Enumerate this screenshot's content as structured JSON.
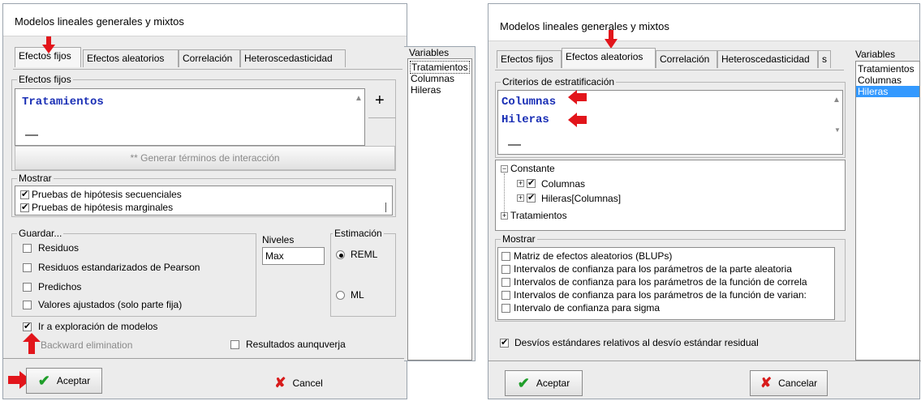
{
  "left": {
    "title": "Modelos lineales generales y mixtos",
    "tabs": [
      "Efectos fijos",
      "Efectos aleatorios",
      "Correlación",
      "Heteroscedasticidad"
    ],
    "efectos_fijos": {
      "label": "Efectos fijos",
      "term": "Tratamientos",
      "dash": "—",
      "plus": "+",
      "interaction_button": "** Generar términos de interacción"
    },
    "mostrar": {
      "label": "Mostrar",
      "items": [
        "Pruebas de hipótesis secuenciales",
        "Pruebas de hipótesis marginales"
      ]
    },
    "guardar": {
      "label": "Guardar...",
      "items": [
        "Residuos",
        "Residuos estandarizados de Pearson",
        "Predichos",
        "Valores ajustados (solo parte fija)"
      ]
    },
    "niveles": {
      "label": "Niveles",
      "value": "Max"
    },
    "estimacion": {
      "label": "Estimación",
      "options": [
        "REML",
        "ML"
      ]
    },
    "ir_exploracion": "Ir a exploración de modelos",
    "backward": "Backward elimination",
    "resultados": "Resultados aunquverja",
    "variables": {
      "label": "Variables",
      "items": [
        "Tratamientos",
        "Columnas",
        "Hileras"
      ]
    },
    "aceptar": "Aceptar",
    "cancel": "Cancel"
  },
  "right": {
    "title": "Modelos lineales generales y mixtos",
    "tabs": [
      "Efectos fijos",
      "Efectos aleatorios",
      "Correlación",
      "Heteroscedasticidad",
      "s"
    ],
    "criterios": {
      "label": "Criterios de estratificación",
      "items": [
        "Columnas",
        "Hileras"
      ],
      "dash": "—"
    },
    "tree": {
      "root": "Constante",
      "children": [
        "Columnas",
        "Hileras[Columnas]"
      ],
      "other": "Tratamientos"
    },
    "mostrar": {
      "label": "Mostrar",
      "items": [
        "Matriz de efectos aleatorios (BLUPs)",
        "Intervalos de confianza para los parámetros de la parte aleatoria",
        "Intervalos de confianza para los parámetros de la función de correla",
        "Intervalos de confianza para los parámetros de la función de varian:",
        "Intervalo de confianza para sigma"
      ]
    },
    "desvios": "Desvíos estándares relativos al desvío estándar residual",
    "variables": {
      "label": "Variables",
      "items": [
        "Tratamientos",
        "Columnas",
        "Hileras"
      ]
    },
    "aceptar": "Aceptar",
    "cancelar": "Cancelar"
  },
  "colors": {
    "accent_red": "#e2151b",
    "term_blue": "#1a2fb5",
    "selection_blue": "#3399ff"
  }
}
